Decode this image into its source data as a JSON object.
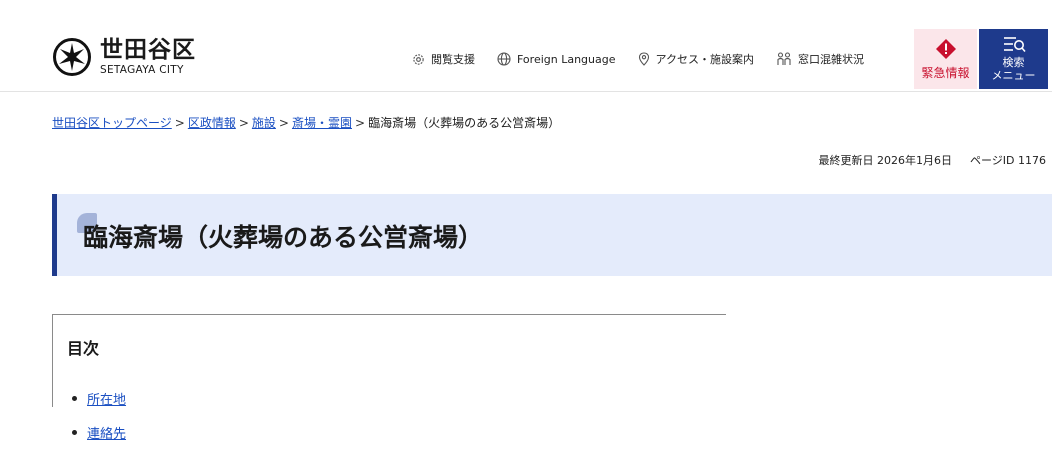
{
  "header": {
    "logo_name": "世田谷区",
    "logo_sub": "SETAGAYA CITY",
    "nav": [
      {
        "label": "閲覧支援",
        "icon": "gear-icon"
      },
      {
        "label": "Foreign Language",
        "icon": "globe-icon"
      },
      {
        "label": "アクセス・施設案内",
        "icon": "location-pin-icon"
      },
      {
        "label": "窓口混雑状況",
        "icon": "people-icon"
      }
    ],
    "emergency_label": "緊急情報",
    "search_menu_label": "検索\nメニュー",
    "accent_color": "#1e3a8c",
    "emergency_color": "#c8102e"
  },
  "breadcrumb": {
    "items": [
      "世田谷区トップページ",
      "区政情報",
      "施設",
      "斎場・霊園"
    ],
    "current": "臨海斎場（火葬場のある公営斎場）",
    "separator": ">"
  },
  "meta": {
    "updated": "最終更新日 2026年1月6日",
    "page_id": "ページID 1176"
  },
  "title": "臨海斎場（火葬場のある公営斎場）",
  "toc": {
    "heading": "目次",
    "items": [
      "所在地",
      "連絡先"
    ]
  }
}
